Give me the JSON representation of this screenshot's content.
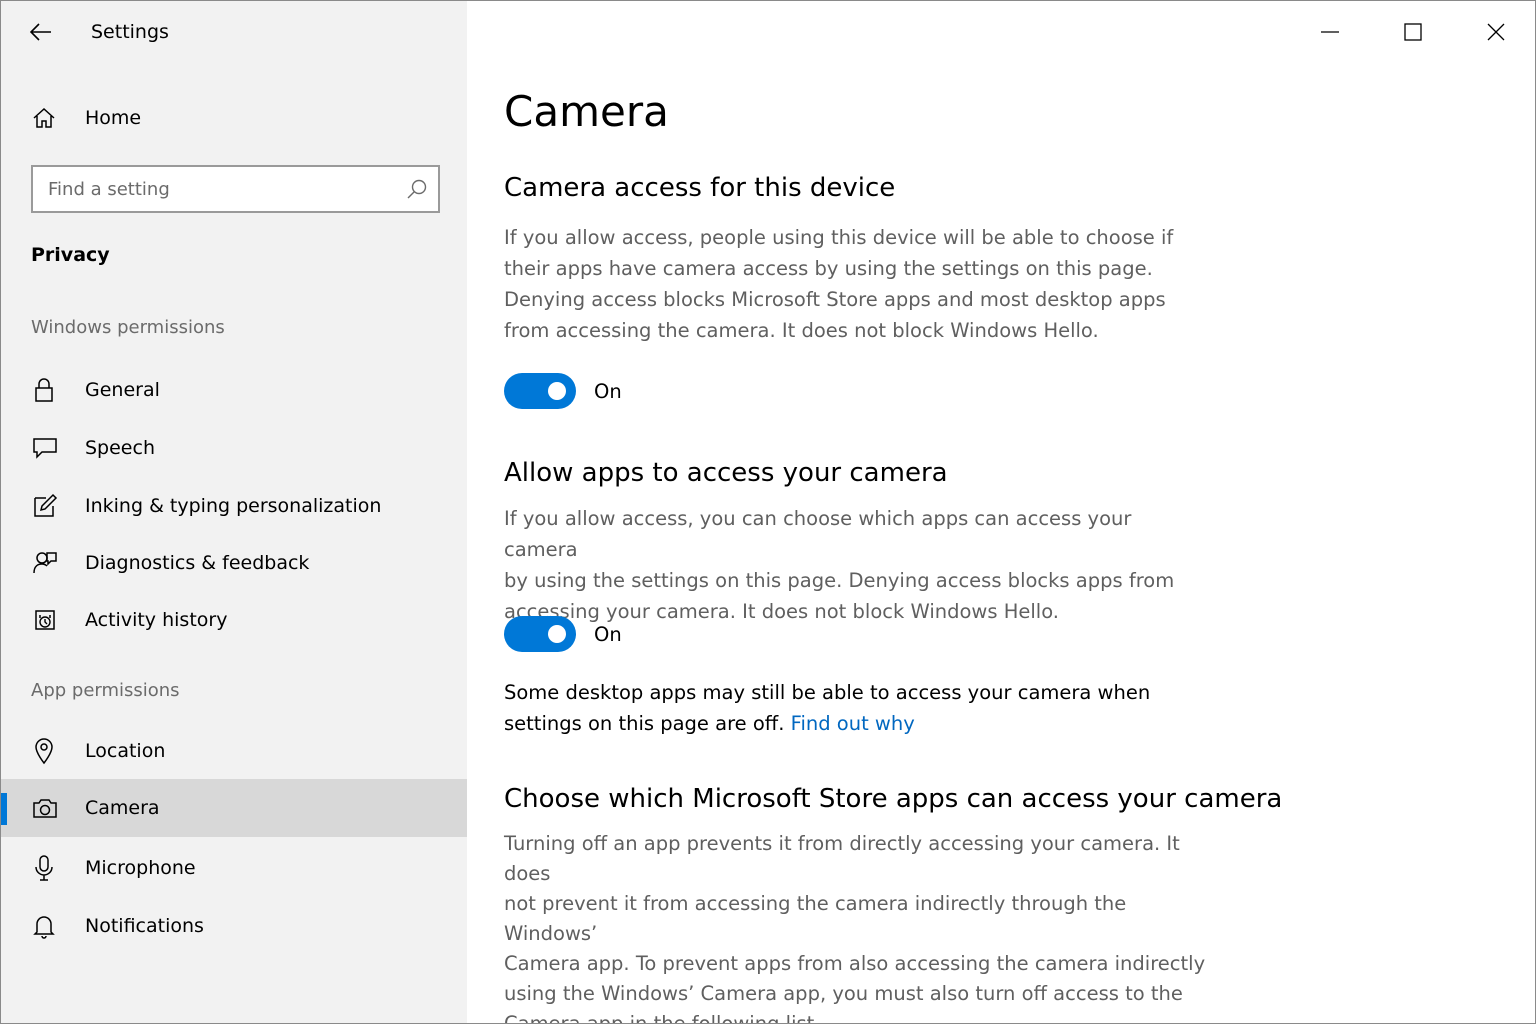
{
  "window": {
    "title": "Settings"
  },
  "sidebar": {
    "home_label": "Home",
    "search_placeholder": "Find a setting",
    "section_title": "Privacy",
    "windows_permissions_header": "Windows permissions",
    "windows_permissions": [
      {
        "label": "General",
        "icon": "lock-icon"
      },
      {
        "label": "Speech",
        "icon": "speech-icon"
      },
      {
        "label": "Inking & typing personalization",
        "icon": "inking-icon"
      },
      {
        "label": "Diagnostics & feedback",
        "icon": "diagnostics-icon"
      },
      {
        "label": "Activity history",
        "icon": "activity-history-icon"
      }
    ],
    "app_permissions_header": "App permissions",
    "app_permissions": [
      {
        "label": "Location",
        "icon": "location-pin-icon",
        "selected": false
      },
      {
        "label": "Camera",
        "icon": "camera-icon",
        "selected": true
      },
      {
        "label": "Microphone",
        "icon": "microphone-icon",
        "selected": false
      },
      {
        "label": "Notifications",
        "icon": "bell-icon",
        "selected": false
      }
    ]
  },
  "main": {
    "page_title": "Camera",
    "device_access": {
      "heading": "Camera access for this device",
      "description_lines": [
        "If you allow access, people using this device will be able to choose if",
        "their apps have camera access by using the settings on this page.",
        "Denying access blocks Microsoft Store apps and most desktop apps",
        "from accessing the camera. It does not block Windows Hello."
      ],
      "toggle_state": "On"
    },
    "apps_access": {
      "heading": "Allow apps to access your camera",
      "description_lines": [
        "If you allow access, you can choose which apps can access your camera",
        "by using the settings on this page. Denying access blocks apps from",
        "accessing your camera. It does not block Windows Hello."
      ],
      "toggle_state": "On"
    },
    "desktop_note": {
      "line1": "Some desktop apps may still be able to access your camera when",
      "line2_text": "settings on this page are off. ",
      "link": "Find out why"
    },
    "store_apps": {
      "heading": "Choose which Microsoft Store apps can access your camera",
      "description_lines": [
        "Turning off an app prevents it from directly accessing your camera. It does",
        "not prevent it from accessing the camera indirectly through the Windows’",
        "Camera app. To prevent apps from also accessing the camera indirectly",
        "using the Windows’ Camera app, you must also turn off access to the",
        "Camera app in the following list."
      ]
    }
  },
  "colors": {
    "accent": "#0078d7",
    "sidebar_bg": "#f2f2f2",
    "selected_bg": "#d8d8d8",
    "link": "#0067c0"
  }
}
